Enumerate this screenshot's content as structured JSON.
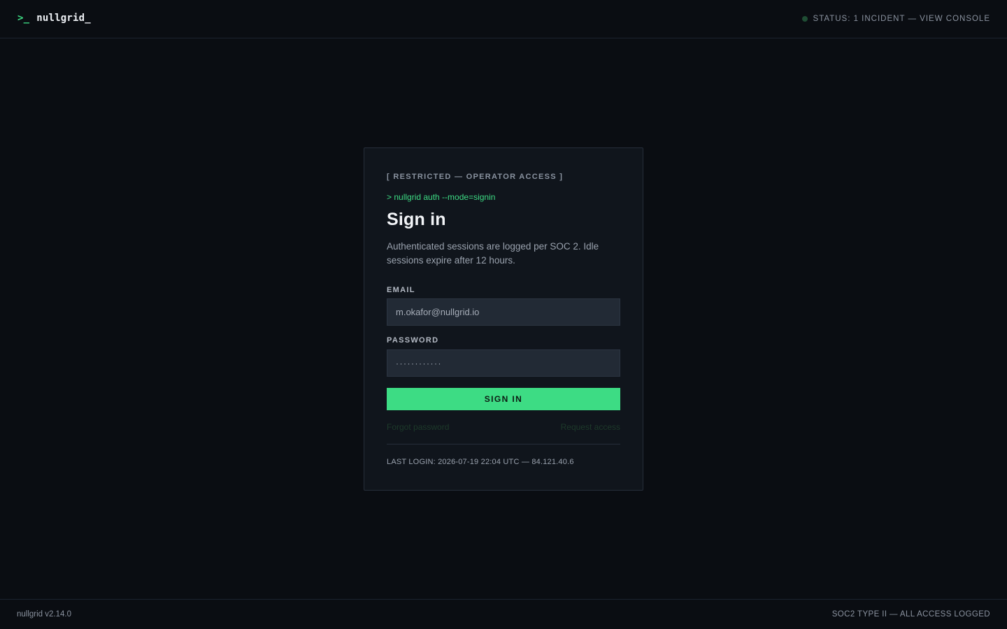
{
  "header": {
    "brand_icon": ">_",
    "brand_name": "nullgrid_",
    "status_text": "STATUS: 1 INCIDENT — VIEW CONSOLE",
    "status_color": "#1f4d34"
  },
  "card": {
    "restricted_label": "[ RESTRICTED — OPERATOR ACCESS ]",
    "command": "> nullgrid auth --mode=signin",
    "title": "Sign in",
    "subtitle": "Authenticated sessions are logged per SOC 2. Idle sessions expire after 12 hours.",
    "email_label": "EMAIL",
    "email_value": "m.okafor@nullgrid.io",
    "password_label": "PASSWORD",
    "password_value": "············",
    "signin_label": "SIGN IN",
    "forgot_label": "Forgot password",
    "request_label": "Request access",
    "last_login": "LAST LOGIN: 2026-07-19 22:04 UTC — 84.121.40.6"
  },
  "footer": {
    "version": "nullgrid v2.14.0",
    "compliance": "SOC2 TYPE II — ALL ACCESS LOGGED"
  },
  "colors": {
    "accent": "#3ddc84",
    "background": "#0a0d12",
    "card_background": "#10151c",
    "input_background": "#222a35"
  }
}
